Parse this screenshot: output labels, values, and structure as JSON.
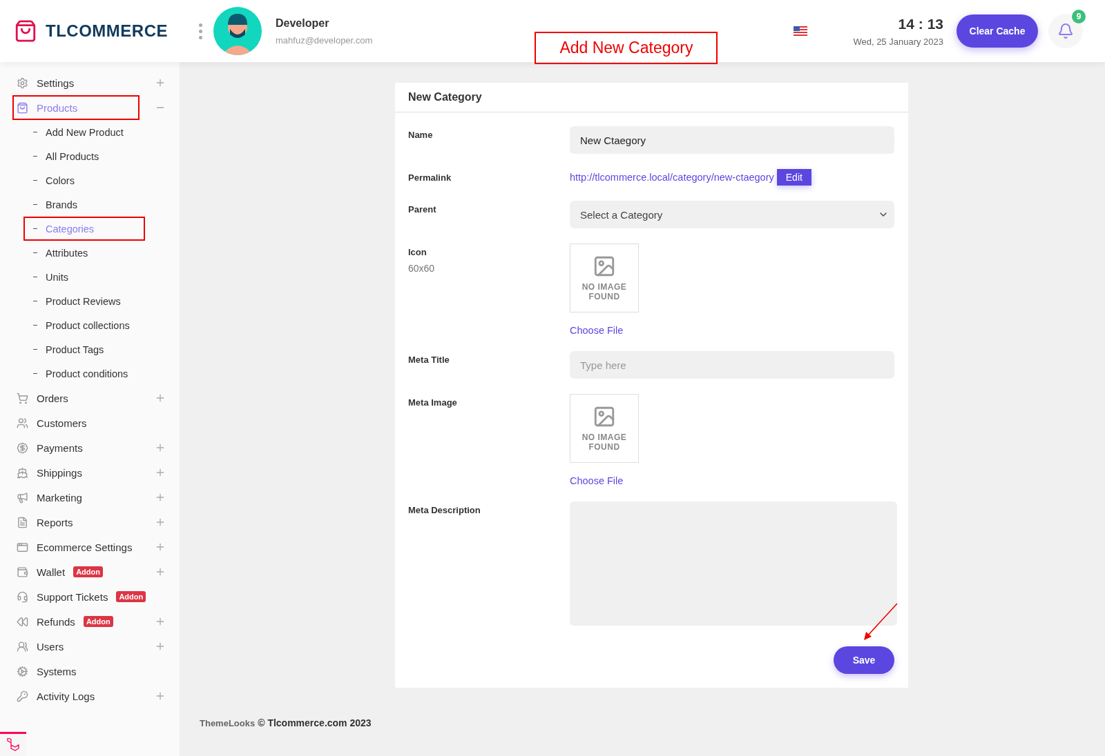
{
  "header": {
    "brand": "TLCOMMERCE",
    "user": {
      "name": "Developer",
      "email": "mahfuz@developer.com"
    },
    "time": "14 : 13",
    "date": "Wed, 25 January 2023",
    "clear_cache": "Clear Cache",
    "notification_count": "9"
  },
  "annotation": {
    "label": "Add New Category"
  },
  "sidebar": {
    "items": [
      {
        "label": "Settings",
        "expanded": false,
        "selected": false,
        "highlighted": false
      },
      {
        "label": "Products",
        "expanded": true,
        "selected": true,
        "highlighted": true,
        "children": [
          {
            "label": "Add New Product",
            "selected": false,
            "highlighted": false
          },
          {
            "label": "All Products",
            "selected": false,
            "highlighted": false
          },
          {
            "label": "Colors",
            "selected": false,
            "highlighted": false
          },
          {
            "label": "Brands",
            "selected": false,
            "highlighted": false
          },
          {
            "label": "Categories",
            "selected": true,
            "highlighted": true
          },
          {
            "label": "Attributes",
            "selected": false,
            "highlighted": false
          },
          {
            "label": "Units",
            "selected": false,
            "highlighted": false
          },
          {
            "label": "Product Reviews",
            "selected": false,
            "highlighted": false
          },
          {
            "label": "Product collections",
            "selected": false,
            "highlighted": false
          },
          {
            "label": "Product Tags",
            "selected": false,
            "highlighted": false
          },
          {
            "label": "Product conditions",
            "selected": false,
            "highlighted": false
          }
        ]
      },
      {
        "label": "Orders",
        "expanded": false,
        "selected": false,
        "highlighted": false
      },
      {
        "label": "Customers",
        "selected": false,
        "highlighted": false
      },
      {
        "label": "Payments",
        "expanded": false,
        "selected": false,
        "highlighted": false
      },
      {
        "label": "Shippings",
        "expanded": false,
        "selected": false,
        "highlighted": false
      },
      {
        "label": "Marketing",
        "expanded": false,
        "selected": false,
        "highlighted": false
      },
      {
        "label": "Reports",
        "expanded": false,
        "selected": false,
        "highlighted": false
      },
      {
        "label": "Ecommerce Settings",
        "expanded": false,
        "selected": false,
        "highlighted": false
      },
      {
        "label": "Wallet",
        "badge": "Addon",
        "expanded": false,
        "selected": false,
        "highlighted": false
      },
      {
        "label": "Support Tickets",
        "badge": "Addon",
        "selected": false,
        "highlighted": false
      },
      {
        "label": "Refunds",
        "badge": "Addon",
        "expanded": false,
        "selected": false,
        "highlighted": false
      },
      {
        "label": "Users",
        "expanded": false,
        "selected": false,
        "highlighted": false
      },
      {
        "label": "Systems",
        "selected": false,
        "highlighted": false
      },
      {
        "label": "Activity Logs",
        "expanded": false,
        "selected": false,
        "highlighted": false
      }
    ]
  },
  "form": {
    "title": "New Category",
    "fields": [
      {
        "kind": "text",
        "label": "Name",
        "value": "New Ctaegory"
      },
      {
        "kind": "link",
        "label": "Permalink",
        "url": "http://tlcommerce.local/category/new-ctaegory",
        "button": "Edit"
      },
      {
        "kind": "select",
        "label": "Parent",
        "value": "Select a Category"
      },
      {
        "kind": "image",
        "label": "Icon",
        "hint": "60x60",
        "image_text": "NO IMAGE FOUND",
        "choose": "Choose File"
      },
      {
        "kind": "text",
        "label": "Meta Title",
        "placeholder": "Type here"
      },
      {
        "kind": "image",
        "label": "Meta Image",
        "image_text": "NO IMAGE FOUND",
        "choose": "Choose File"
      },
      {
        "kind": "textarea",
        "label": "Meta Description"
      }
    ],
    "save": "Save"
  },
  "footer": {
    "company": "ThemeLooks",
    "copyright": "© Tlcommerce.com 2023"
  }
}
